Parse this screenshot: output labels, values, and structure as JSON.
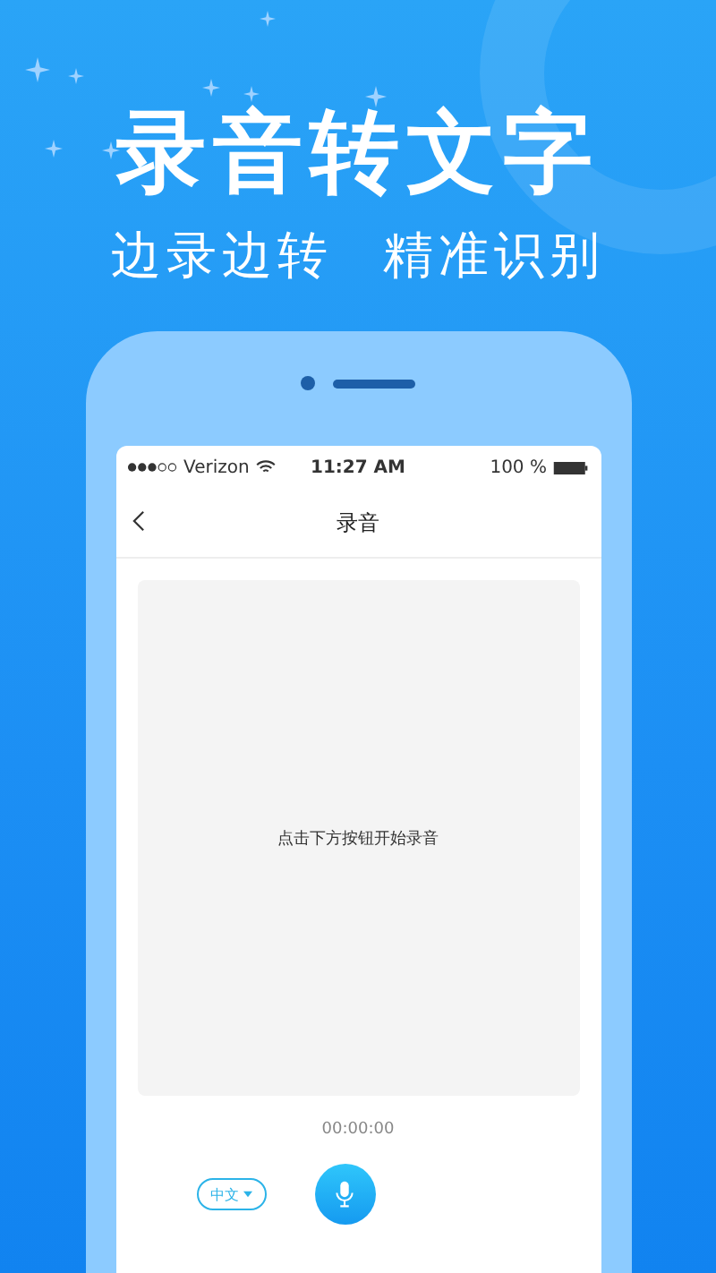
{
  "headline": "录音转文字",
  "subtitles": [
    "边录边转",
    "精准识别"
  ],
  "status_bar": {
    "carrier": "Verizon",
    "time": "11:27 AM",
    "battery": "100 %"
  },
  "nav": {
    "title": "录音"
  },
  "recording_area": {
    "hint": "点击下方按钮开始录音"
  },
  "timer": "00:00:00",
  "language_button": {
    "label": "中文"
  }
}
